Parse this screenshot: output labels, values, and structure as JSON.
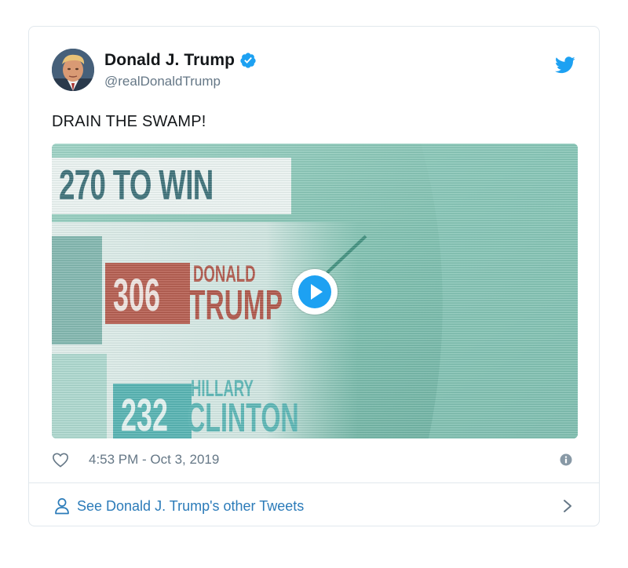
{
  "author": {
    "display_name": "Donald J. Trump",
    "handle": "@realDonaldTrump",
    "verified": true
  },
  "tweet": {
    "text": "DRAIN THE SWAMP!",
    "timestamp": "4:53 PM - Oct 3, 2019"
  },
  "media": {
    "type": "video",
    "frame_text": {
      "headline": "270 TO WIN",
      "trump_votes": "306",
      "trump_first": "DONALD",
      "trump_last": "TRUMP",
      "clinton_votes": "232",
      "clinton_first": "HILLARY",
      "clinton_last": "CLINTON"
    }
  },
  "footer": {
    "link_label": "See Donald J. Trump's other Tweets"
  },
  "icons": {
    "brand": "twitter-bird-icon",
    "verified": "verified-badge-icon",
    "like": "heart-icon",
    "info": "info-icon",
    "play": "play-icon",
    "user": "person-icon",
    "next": "chevron-right-icon"
  },
  "colors": {
    "twitter_blue": "#1da1f2",
    "link_blue": "#2b7bb9",
    "secondary_text": "#657786",
    "border": "#e1e8ed",
    "trump_red": "#b05447",
    "clinton_teal": "#59b5b4"
  }
}
